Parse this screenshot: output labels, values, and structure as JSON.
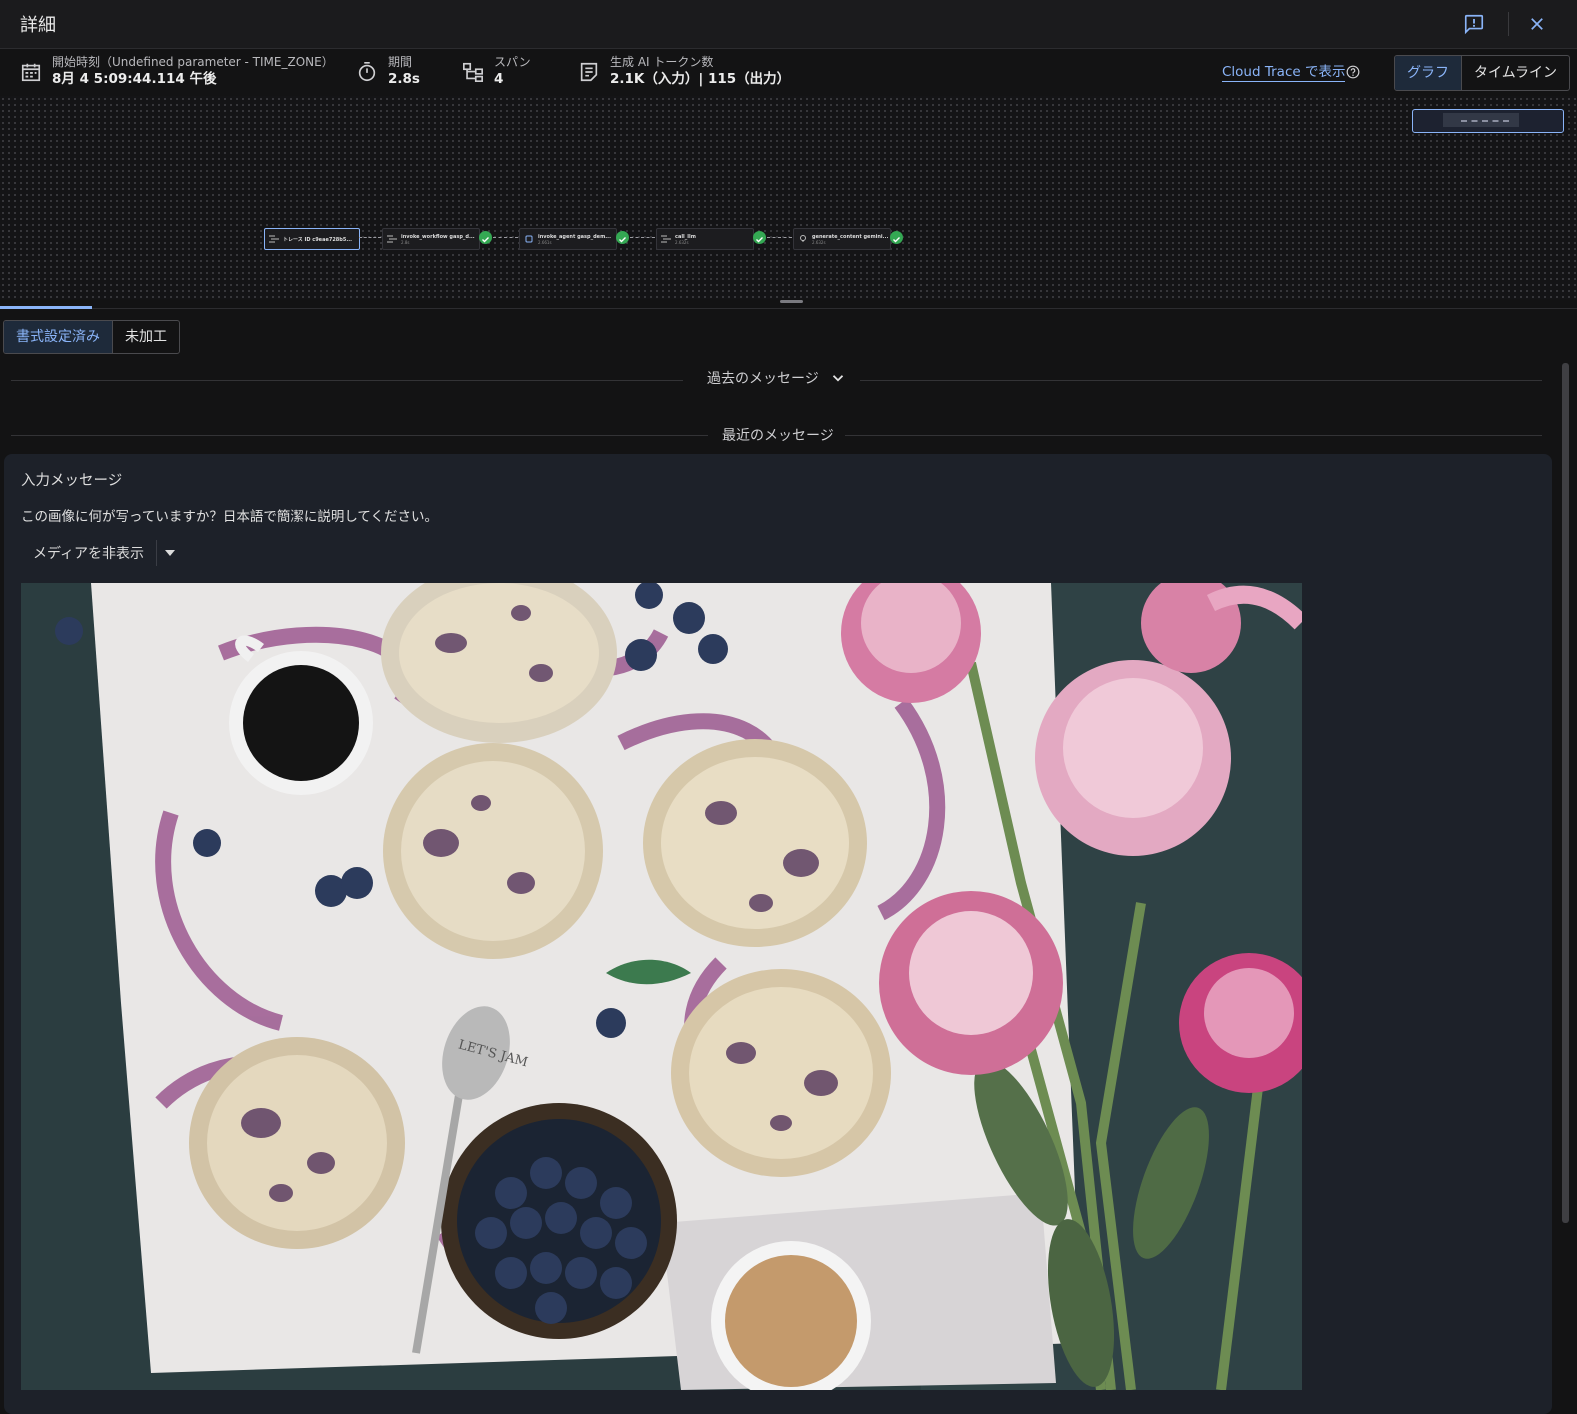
{
  "header": {
    "title": "詳細",
    "feedback_icon": "feedback-icon",
    "close_icon": "close-icon"
  },
  "meta": {
    "start": {
      "label": "開始時刻（Undefined parameter - TIME_ZONE）",
      "value": "8月 4 5:09:44.114 午後",
      "icon": "calendar-icon"
    },
    "duration": {
      "label": "期間",
      "value": "2.8s",
      "icon": "timer-icon"
    },
    "spans": {
      "label": "スパン",
      "value": "4",
      "icon": "hierarchy-icon"
    },
    "tokens": {
      "label": "生成 AI トークン数",
      "value": "2.1K（入力）| 115（出力）",
      "icon": "notes-icon"
    },
    "cloud_trace": "Cloud Trace で表示",
    "view_modes": [
      "グラフ",
      "タイムライン"
    ],
    "active_view": "グラフ"
  },
  "graph": {
    "nodes": [
      {
        "title": "トレース ID c9eae728b5...",
        "sub": "",
        "status": "selected"
      },
      {
        "title": "invoke_workflow gasp_d...",
        "sub": "2.8s",
        "status": "ok"
      },
      {
        "title": "invoke_agent gasp_dem...",
        "sub": "2.661s",
        "status": "ok"
      },
      {
        "title": "call_llm",
        "sub": "2.632s",
        "status": "ok"
      },
      {
        "title": "generate_content gemini...",
        "sub": "2.632s",
        "status": "ok"
      }
    ],
    "accent": "#8ab4f8",
    "ok_color": "#34a853"
  },
  "format_tabs": [
    "書式設定済み",
    "未加工"
  ],
  "active_format": "書式設定済み",
  "sections": {
    "past": "過去のメッセージ",
    "recent": "最近のメッセージ"
  },
  "message": {
    "heading": "入力メッセージ",
    "text": "この画像に何が写っていますか？日本語で簡潔に説明してください。",
    "media_toggle": "メディアを非表示",
    "image_label": "LET'S JAM"
  }
}
